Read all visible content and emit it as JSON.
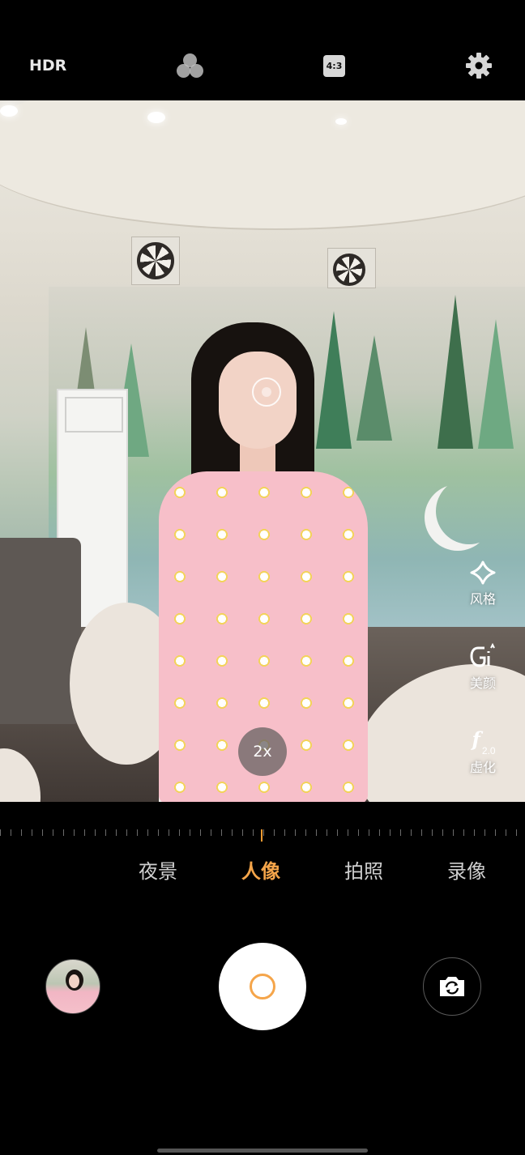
{
  "topbar": {
    "hdr_label": "HDR",
    "filter_icon": "color-filter-icon",
    "ratio_label": "4:3",
    "settings_icon": "gear-icon"
  },
  "viewfinder": {
    "zoom_label": "2x",
    "tools": [
      {
        "icon": "style-diamond-icon",
        "label": "风格"
      },
      {
        "icon": "beauty-face-icon",
        "label": "美颜"
      },
      {
        "icon": "aperture-f-icon",
        "f_symbol": "f",
        "f_value": "2.0",
        "label": "虚化"
      }
    ]
  },
  "modes": {
    "items": [
      "夜景",
      "人像",
      "拍照",
      "录像"
    ],
    "active": "人像"
  },
  "bottom": {
    "thumbnail": "last-photo-thumbnail",
    "shutter": "shutter-button",
    "flip": "switch-camera-icon"
  },
  "colors": {
    "accent": "#f5a54a",
    "background": "#000000"
  }
}
